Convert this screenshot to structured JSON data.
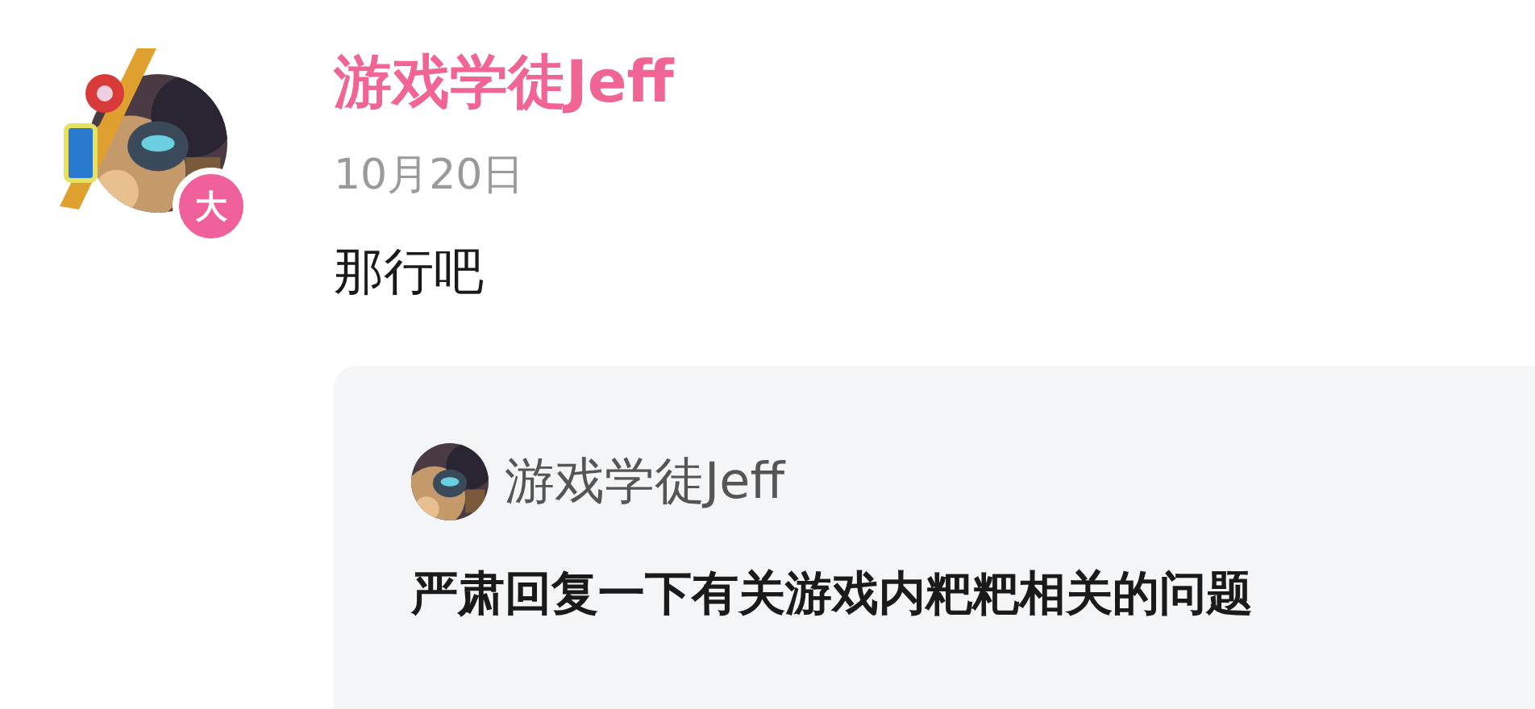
{
  "author": {
    "name": "游戏学徒Jeff",
    "badge": "大"
  },
  "date": "10月20日",
  "message": "那行吧",
  "quote": {
    "author": "游戏学徒Jeff",
    "title": "严肃回复一下有关游戏内粑粑相关的问题"
  }
}
